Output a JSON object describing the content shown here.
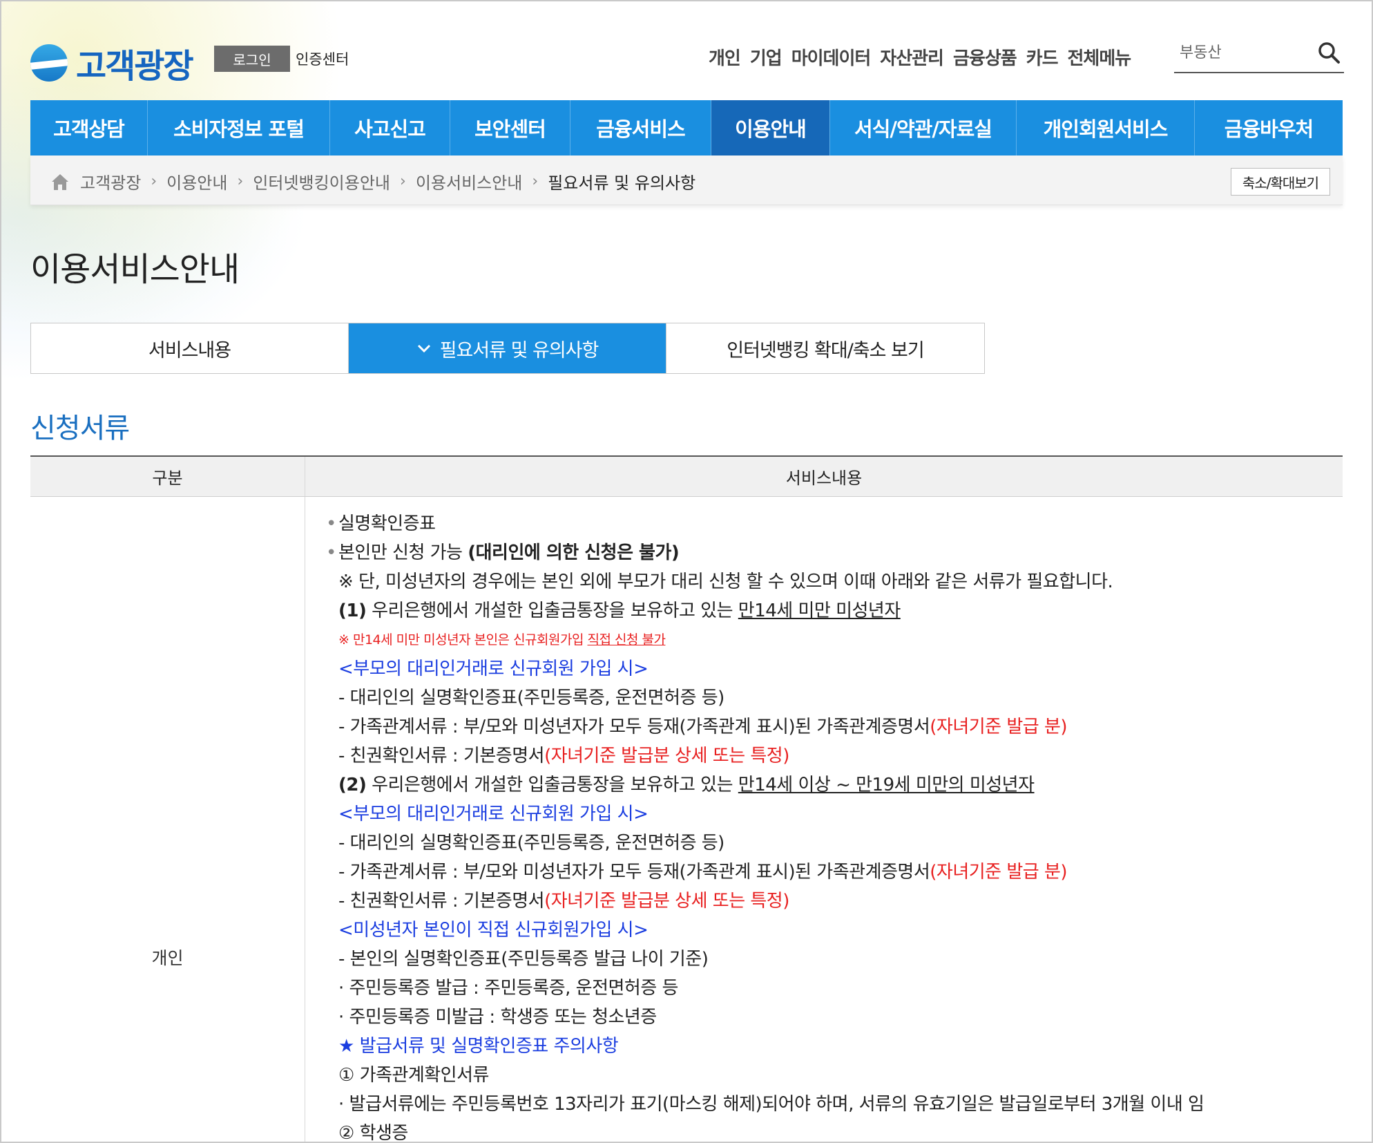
{
  "header": {
    "logo_text": "고객광장",
    "login_label": "로그인",
    "cert_label": "인증센터",
    "top_nav": [
      "개인",
      "기업",
      "마이데이터",
      "자산관리",
      "금융상품",
      "카드",
      "전체메뉴"
    ],
    "search_value": "부동산"
  },
  "main_nav": {
    "items": [
      "고객상담",
      "소비자정보 포털",
      "사고신고",
      "보안센터",
      "금융서비스",
      "이용안내",
      "서식/약관/자료실",
      "개인회원서비스",
      "금융바우처"
    ],
    "active": "이용안내"
  },
  "breadcrumb": {
    "items": [
      "고객광장",
      "이용안내",
      "인터넷뱅킹이용안내",
      "이용서비스안내",
      "필요서류 및 유의사항"
    ],
    "zoom_label": "축소/확대보기"
  },
  "page_title": "이용서비스안내",
  "tabs": {
    "items": [
      "서비스내용",
      "필요서류 및 유의사항",
      "인터넷뱅킹 확대/축소 보기"
    ],
    "active": "필요서류 및 유의사항"
  },
  "section_title": "신청서류",
  "table": {
    "headers": [
      "구분",
      "서비스내용"
    ],
    "row_label": "개인",
    "content": {
      "l1": "실명확인증표",
      "l2a": "본인만 신청 가능 ",
      "l2b": "(대리인에 의한 신청은 불가)",
      "l3": "※ 단, 미성년자의 경우에는 본인 외에 부모가 대리 신청 할 수 있으며 이때 아래와 같은 서류가 필요합니다.",
      "l4a": "(1)",
      "l4b": " 우리은행에서 개설한 입출금통장을 보유하고 있는 ",
      "l4c": "만14세 미만 미성년자",
      "l5a": "※ 만14세 미만 미성년자 본인은 신규회원가입 ",
      "l5b": "직접 신청 불가",
      "l6": "<부모의 대리인거래로 신규회원 가입 시>",
      "l7": "- 대리인의 실명확인증표(주민등록증, 운전면허증 등)",
      "l8a": "- 가족관계서류 : 부/모와 미성년자가 모두 등재(가족관계 표시)된 가족관계증명서",
      "l8b": "(자녀기준 발급 분)",
      "l9a": "- 친권확인서류 : 기본증명서",
      "l9b": "(자녀기준 발급분 상세 또는 특정)",
      "l10a": "(2)",
      "l10b": " 우리은행에서 개설한 입출금통장을 보유하고 있는 ",
      "l10c": "만14세 이상 ~ 만19세 미만의 미성년자",
      "l11": "<부모의 대리인거래로 신규회원 가입 시>",
      "l12": "- 대리인의 실명확인증표(주민등록증, 운전면허증 등)",
      "l13a": "- 가족관계서류 : 부/모와 미성년자가 모두 등재(가족관계 표시)된 가족관계증명서",
      "l13b": "(자녀기준 발급 분)",
      "l14a": "- 친권확인서류 : 기본증명서",
      "l14b": "(자녀기준 발급분 상세 또는 특정)",
      "l15": "<미성년자 본인이 직접 신규회원가입 시>",
      "l16": "- 본인의 실명확인증표(주민등록증 발급 나이 기준)",
      "l17": "· 주민등록증 발급 : 주민등록증, 운전면허증 등",
      "l18": "· 주민등록증 미발급 : 학생증 또는 청소년증",
      "l19": "★ 발급서류 및 실명확인증표 주의사항",
      "l20": "① 가족관계확인서류",
      "l21": "· 발급서류에는 주민등록번호 13자리가 표기(마스킹 해제)되어야 하며, 서류의 유효기일은 발급일로부터 3개월 이내 임",
      "l22": "② 학생증"
    }
  },
  "colors": {
    "nav_blue": "#1a8fe0",
    "nav_active": "#1668b8",
    "section_title": "#1a6fc0",
    "red_text": "#e82020",
    "blue_text": "#1a3de0"
  }
}
